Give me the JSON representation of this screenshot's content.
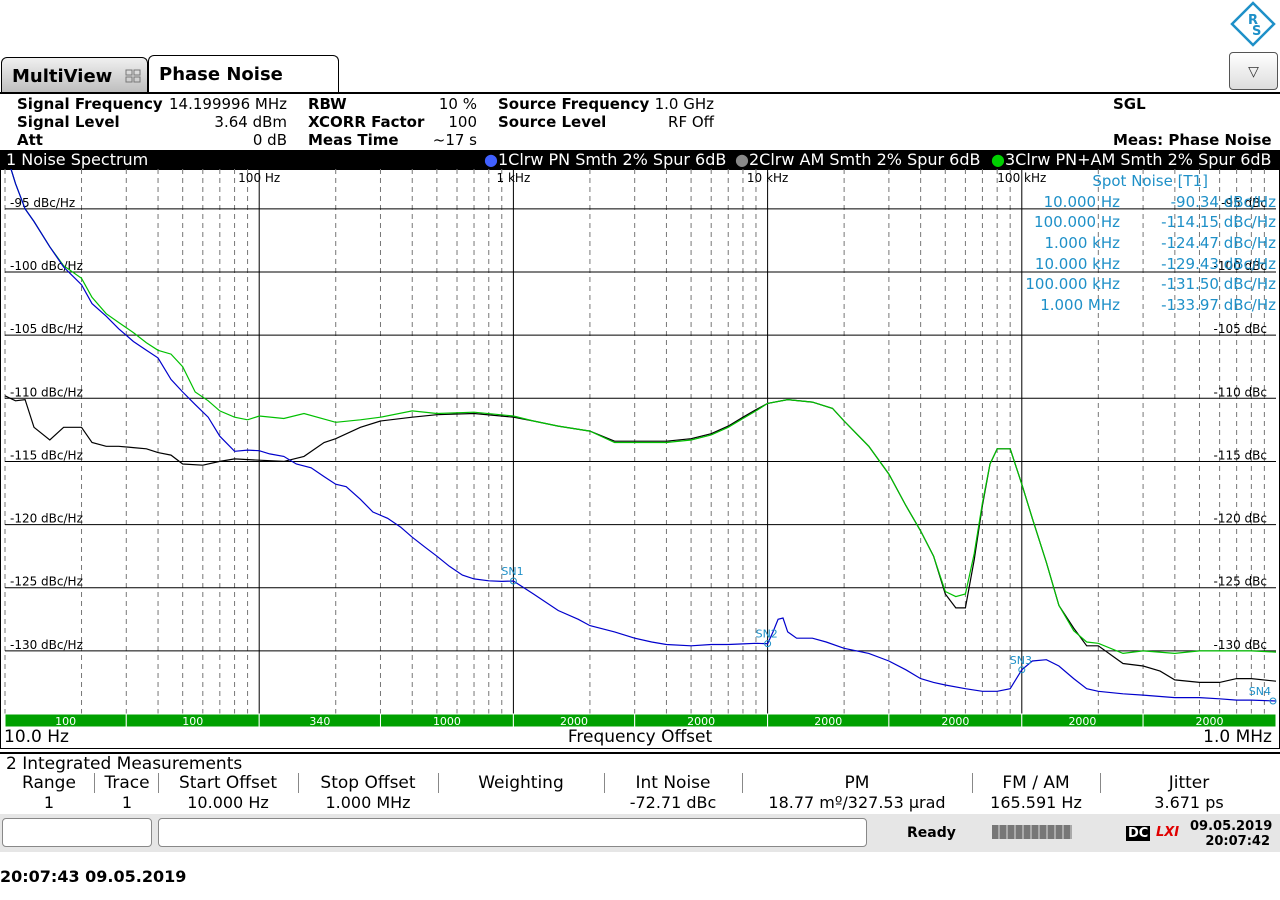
{
  "tabs": {
    "multiview": "MultiView",
    "phase_noise": "Phase Noise"
  },
  "header": {
    "signal_frequency_label": "Signal Frequency",
    "signal_frequency_value": "14.199996 MHz",
    "signal_level_label": "Signal Level",
    "signal_level_value": "3.64 dBm",
    "att_label": "Att",
    "att_value": "0 dB",
    "rbw_label": "RBW",
    "rbw_value": "10 %",
    "xcorr_label": "XCORR Factor",
    "xcorr_value": "100",
    "meas_time_label": "Meas Time",
    "meas_time_value": "~17 s",
    "source_frequency_label": "Source Frequency",
    "source_frequency_value": "1.0 GHz",
    "source_level_label": "Source Level",
    "source_level_value": "RF Off",
    "sgl": "SGL",
    "meas": "Meas: Phase Noise"
  },
  "window": {
    "title": "1 Noise Spectrum",
    "trace1": "1Clrw PN Smth 2% Spur 6dB",
    "trace2": "2Clrw AM Smth 2% Spur 6dB",
    "trace3": "3Clrw PN+AM Smth 2% Spur 6dB",
    "x_start": "10.0 Hz",
    "x_label": "Frequency Offset",
    "x_stop": "1.0 MHz"
  },
  "spot_noise": {
    "title": "Spot Noise [T1]",
    "rows": [
      {
        "freq": "10.000 Hz",
        "value": "-90.34 dBc/Hz"
      },
      {
        "freq": "100.000 Hz",
        "value": "-114.15 dBc/Hz"
      },
      {
        "freq": "1.000 kHz",
        "value": "-124.47 dBc/Hz"
      },
      {
        "freq": "10.000 kHz",
        "value": "-129.43 dBc/Hz"
      },
      {
        "freq": "100.000 kHz",
        "value": "-131.50 dBc/Hz"
      },
      {
        "freq": "1.000 MHz",
        "value": "-133.97 dBc/Hz"
      }
    ]
  },
  "xcorr_bar": [
    "100",
    "100",
    "340",
    "1000",
    "2000",
    "2000",
    "2000",
    "2000",
    "2000",
    "2000"
  ],
  "markers": [
    "SN1",
    "SN2",
    "SN3",
    "SN4"
  ],
  "integrated": {
    "title": "2 Integrated Measurements",
    "headers": [
      "Range",
      "Trace",
      "Start Offset",
      "Stop Offset",
      "Weighting",
      "Int Noise",
      "PM",
      "FM / AM",
      "Jitter"
    ],
    "row": [
      "1",
      "1",
      "10.000 Hz",
      "1.000 MHz",
      "",
      "-72.71 dBc",
      "18.77 mº/327.53 µrad",
      "165.591 Hz",
      "3.671 ps"
    ]
  },
  "status": {
    "ready": "Ready",
    "dc": "DC",
    "lxi": "LXI",
    "date": "09.05.2019",
    "time": "20:07:42"
  },
  "timestamp": "20:07:43  09.05.2019",
  "colors": {
    "pn": "#0000cc",
    "am": "#000000",
    "pnam": "#00c000",
    "annotation": "#1e90c8",
    "xcorr_bar": "#00a000"
  },
  "chart_data": {
    "type": "line",
    "x_scale": "log",
    "xlim": [
      10,
      1000000
    ],
    "ylim": [
      -135,
      -92
    ],
    "x_ticks": [
      {
        "value": 100,
        "label": "100 Hz"
      },
      {
        "value": 1000,
        "label": "1 kHz"
      },
      {
        "value": 10000,
        "label": "10 kHz"
      },
      {
        "value": 100000,
        "label": "100 kHz"
      }
    ],
    "y_ticks": [
      {
        "value": -95,
        "left": "-95 dBc/Hz",
        "right": "-95 dBc"
      },
      {
        "value": -100,
        "left": "-100 dBc/Hz",
        "right": "-100 dBc"
      },
      {
        "value": -105,
        "left": "-105 dBc/Hz",
        "right": "-105 dBc"
      },
      {
        "value": -110,
        "left": "-110 dBc/Hz",
        "right": "-110 dBc"
      },
      {
        "value": -115,
        "left": "-115 dBc/Hz",
        "right": "-115 dBc"
      },
      {
        "value": -120,
        "left": "-120 dBc/Hz",
        "right": "-120 dBc"
      },
      {
        "value": -125,
        "left": "-125 dBc/Hz",
        "right": "-125 dBc"
      },
      {
        "value": -130,
        "left": "-130 dBc/Hz",
        "right": "-130 dBc"
      }
    ],
    "series": [
      {
        "name": "1Clrw PN Smth 2% Spur 6dB",
        "color": "#0000cc",
        "x": [
          10,
          11,
          12,
          13,
          15,
          17,
          20,
          22,
          25,
          28,
          32,
          36,
          40,
          45,
          50,
          56,
          63,
          70,
          80,
          90,
          100,
          110,
          125,
          140,
          160,
          180,
          200,
          220,
          250,
          280,
          320,
          360,
          400,
          450,
          500,
          560,
          630,
          700,
          800,
          900,
          1000,
          1200,
          1500,
          1800,
          2000,
          2500,
          3000,
          3500,
          4000,
          5000,
          6000,
          7000,
          8000,
          9000,
          10000,
          10500,
          11000,
          11500,
          12000,
          13000,
          15000,
          17000,
          20000,
          25000,
          30000,
          35000,
          40000,
          45000,
          50000,
          60000,
          70000,
          80000,
          90000,
          100000,
          110000,
          125000,
          140000,
          160000,
          180000,
          200000,
          250000,
          300000,
          400000,
          500000,
          600000,
          700000,
          800000,
          1000000
        ],
        "y": [
          -90.3,
          -93,
          -95,
          -96,
          -98,
          -99.6,
          -101,
          -102.5,
          -103.5,
          -104.5,
          -105.5,
          -106.2,
          -106.8,
          -108.5,
          -109.5,
          -110.5,
          -111.5,
          -113,
          -114.2,
          -114.1,
          -114.15,
          -114.4,
          -114.6,
          -115.2,
          -115.5,
          -116.2,
          -116.8,
          -117,
          -118,
          -119,
          -119.5,
          -120.2,
          -121,
          -121.8,
          -122.5,
          -123.3,
          -124,
          -124.3,
          -124.45,
          -124.5,
          -124.47,
          -125.5,
          -126.8,
          -127.5,
          -128,
          -128.5,
          -129,
          -129.3,
          -129.5,
          -129.6,
          -129.5,
          -129.5,
          -129.45,
          -129.4,
          -129.43,
          -128.5,
          -127.5,
          -127.4,
          -128.5,
          -129,
          -129,
          -129.3,
          -129.8,
          -130.2,
          -130.8,
          -131.5,
          -132.2,
          -132.5,
          -132.7,
          -133,
          -133.2,
          -133.2,
          -133,
          -131.5,
          -130.8,
          -130.7,
          -131.2,
          -132.2,
          -133,
          -133.2,
          -133.4,
          -133.5,
          -133.7,
          -133.7,
          -133.8,
          -133.9,
          -133.9,
          -133.97
        ]
      },
      {
        "name": "2Clrw AM Smth 2% Spur 6dB",
        "color": "#000000",
        "x": [
          10,
          11,
          12,
          13,
          15,
          17,
          20,
          22,
          25,
          28,
          32,
          36,
          40,
          45,
          50,
          60,
          70,
          80,
          100,
          125,
          150,
          180,
          200,
          250,
          300,
          400,
          500,
          700,
          1000,
          1200,
          1500,
          2000,
          2500,
          3000,
          4000,
          5000,
          6000,
          7000,
          8000,
          9000,
          10000,
          12000,
          15000,
          18000,
          20000,
          25000,
          30000,
          35000,
          40000,
          45000,
          50000,
          55000,
          60000,
          65000,
          70000,
          75000,
          80000,
          90000,
          100000,
          110000,
          125000,
          140000,
          160000,
          180000,
          200000,
          250000,
          300000,
          350000,
          400000,
          500000,
          600000,
          700000,
          800000,
          1000000
        ],
        "y": [
          -109.8,
          -110.2,
          -110.1,
          -112.3,
          -113.3,
          -112.3,
          -112.3,
          -113.5,
          -113.8,
          -113.8,
          -113.9,
          -114,
          -114.3,
          -114.5,
          -115.2,
          -115.3,
          -115,
          -114.8,
          -114.9,
          -115,
          -114.6,
          -113.5,
          -113.2,
          -112.3,
          -111.8,
          -111.5,
          -111.3,
          -111.2,
          -111.5,
          -111.8,
          -112.2,
          -112.6,
          -113.4,
          -113.4,
          -113.4,
          -113.2,
          -112.8,
          -112.2,
          -111.5,
          -110.9,
          -110.4,
          -110.1,
          -110.3,
          -110.8,
          -111.8,
          -113.8,
          -116,
          -118.5,
          -120.5,
          -122.5,
          -125.5,
          -126.6,
          -126.6,
          -122.8,
          -118.5,
          -115.2,
          -114,
          -114,
          -116.8,
          -119.5,
          -123,
          -126.4,
          -128.2,
          -129.6,
          -129.6,
          -131,
          -131.2,
          -131.6,
          -132.3,
          -132.5,
          -132.5,
          -132.2,
          -132.2,
          -132.4
        ]
      },
      {
        "name": "3Clrw PN+AM Smth 2% Spur 6dB",
        "color": "#00c000",
        "x": [
          10,
          11,
          12,
          13,
          15,
          17,
          20,
          22,
          25,
          28,
          32,
          36,
          40,
          45,
          50,
          56,
          63,
          70,
          80,
          90,
          100,
          125,
          150,
          200,
          250,
          300,
          400,
          500,
          700,
          1000,
          1200,
          1500,
          2000,
          2500,
          3000,
          4000,
          5000,
          6000,
          7000,
          8000,
          9000,
          10000,
          12000,
          15000,
          18000,
          20000,
          25000,
          30000,
          35000,
          40000,
          45000,
          50000,
          55000,
          60000,
          65000,
          70000,
          75000,
          80000,
          90000,
          100000,
          110000,
          125000,
          140000,
          160000,
          180000,
          200000,
          250000,
          300000,
          400000,
          500000,
          600000,
          700000,
          800000,
          1000000
        ],
        "y": [
          -90.3,
          -93,
          -95,
          -96,
          -98,
          -99.5,
          -100.5,
          -102,
          -103.3,
          -104,
          -104.8,
          -105.6,
          -106.2,
          -106.5,
          -107.5,
          -109.5,
          -110.2,
          -111,
          -111.5,
          -111.7,
          -111.4,
          -111.6,
          -111.2,
          -111.9,
          -111.7,
          -111.5,
          -111,
          -111.2,
          -111.1,
          -111.4,
          -111.8,
          -112.2,
          -112.6,
          -113.5,
          -113.5,
          -113.5,
          -113.3,
          -112.9,
          -112.3,
          -111.6,
          -111,
          -110.4,
          -110.1,
          -110.3,
          -110.8,
          -111.8,
          -113.8,
          -116,
          -118.5,
          -120.5,
          -122.5,
          -125.3,
          -125.7,
          -125.5,
          -122.3,
          -118.3,
          -115.2,
          -114,
          -114,
          -116.8,
          -119.5,
          -123,
          -126.4,
          -128.4,
          -129.3,
          -129.4,
          -130.2,
          -130,
          -130.2,
          -130,
          -130,
          -130,
          -130,
          -130.1
        ]
      }
    ]
  }
}
